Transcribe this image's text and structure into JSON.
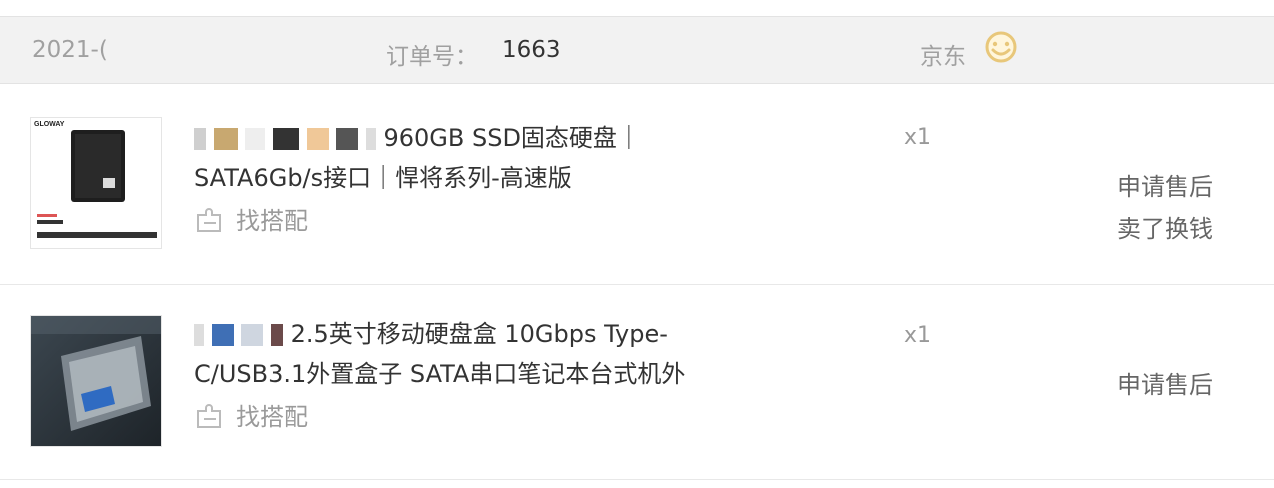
{
  "order": {
    "date": "2021-(",
    "number_label": "订单号：",
    "number": "1663",
    "shop": "京东",
    "chat_icon": "smiley-chat-icon",
    "accent_color": "#e8c77a"
  },
  "items": [
    {
      "title_line1": "960GB SSD固态硬盘｜",
      "title_line2": "SATA6Gb/s接口｜悍将系列-高速版",
      "match_label": "找搭配",
      "quantity": "x1",
      "actions": [
        "申请售后",
        "卖了换钱"
      ],
      "thumb_icon": "ssd-product-image",
      "thumb_brand": "GLOWAY"
    },
    {
      "title_line1": "2.5英寸移动硬盘盒 10Gbps Type-",
      "title_line2": "C/USB3.1外置盒子 SATA串口笔记本台式机外",
      "match_label": "找搭配",
      "quantity": "x1",
      "actions": [
        "申请售后"
      ],
      "thumb_icon": "hdd-enclosure-image"
    }
  ]
}
